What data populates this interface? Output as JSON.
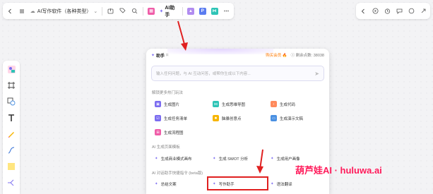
{
  "toolbar": {
    "doc_title": "AI写作软件（各种类型）",
    "ai_label": "AI助手",
    "p_label": "P"
  },
  "panel": {
    "title": "助手",
    "buy_text": "购买会员 🔥",
    "points_text": "剩余点数: 38038",
    "input_placeholder": "输入任何问题，与 AI 互动问答，或帮你生成以下内容...",
    "section1": "解锁更多热门玩法",
    "section1_items": [
      {
        "label": "生成图片",
        "color": "#7b6cf0"
      },
      {
        "label": "生成思维导图",
        "color": "#2ec4b6"
      },
      {
        "label": "生成代码",
        "color": "#ff8a5c"
      },
      {
        "label": "生成任务清单",
        "color": "#7b6cf0"
      },
      {
        "label": "脑暴创意点",
        "color": "#f7b500"
      },
      {
        "label": "生成演示文稿",
        "color": "#4a90e2"
      },
      {
        "label": "生成流程图",
        "color": "#ef5da8"
      }
    ],
    "section2": "AI 生成页面模板",
    "section2_items": [
      {
        "label": "生成商业模式画布"
      },
      {
        "label": "生成 SWOT 分析"
      },
      {
        "label": "生成用户画像"
      }
    ],
    "section3": "AI 对话助手快捷指令 (beta版)",
    "section3_items": [
      {
        "label": "总结文案"
      },
      {
        "label": "写作助手"
      },
      {
        "label": "语法翻译"
      }
    ]
  },
  "watermark": "葫芦娃AI · huluwa.ai",
  "colors": {
    "accent": "#7b6cf0",
    "arrow": "#e02020",
    "watermark": "#ff1a5a"
  }
}
